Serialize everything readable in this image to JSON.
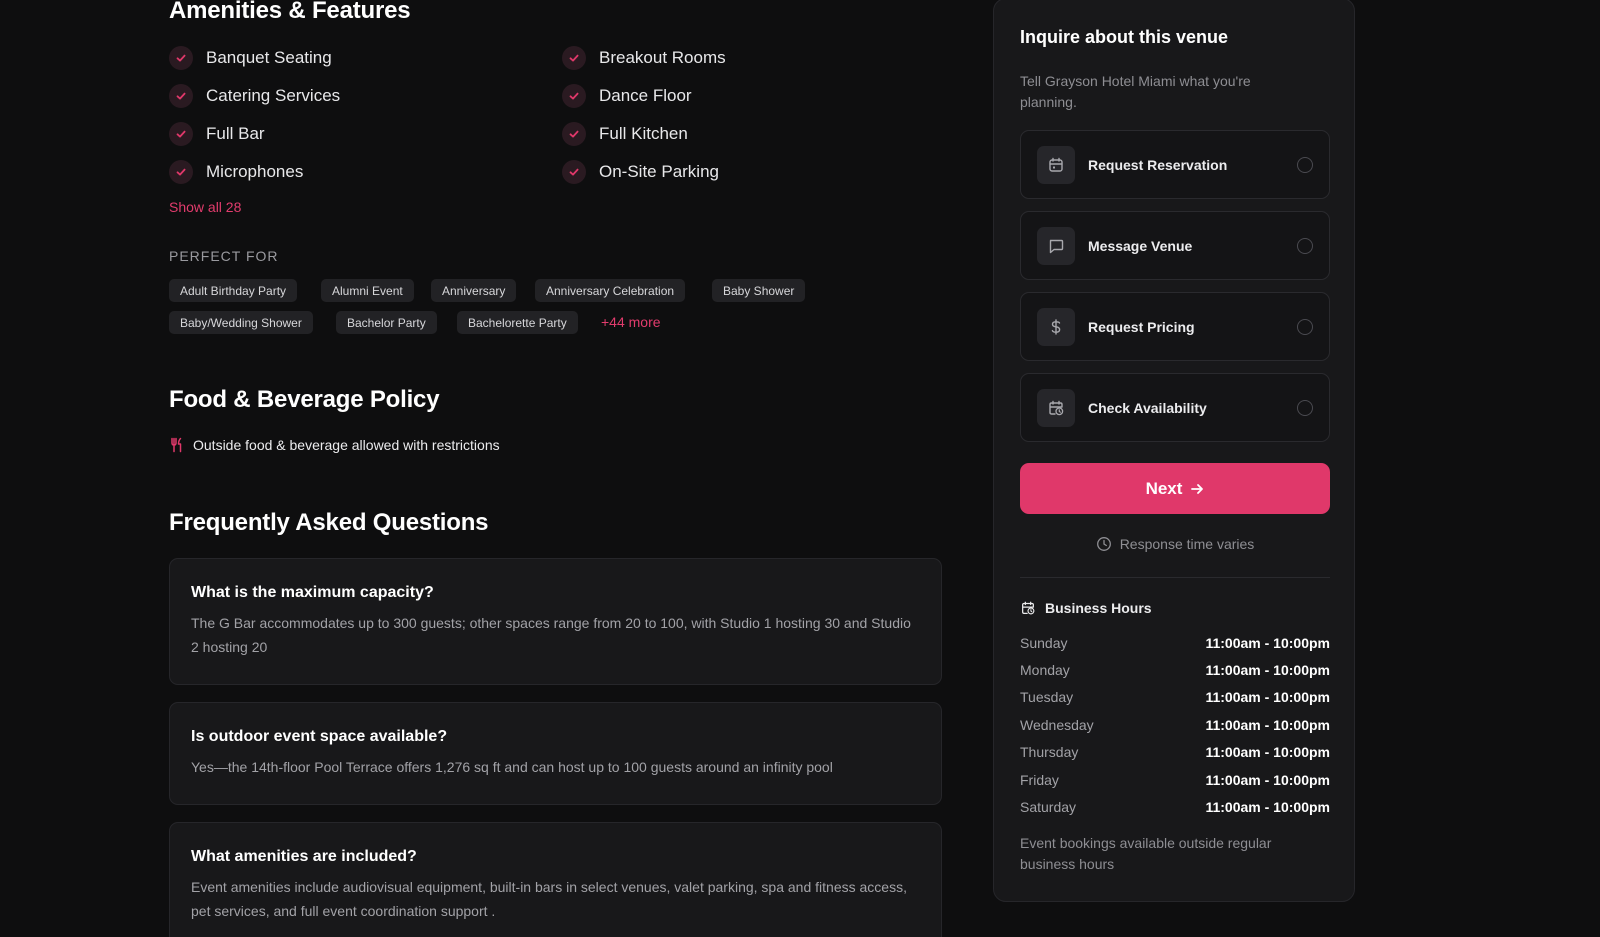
{
  "amenities": {
    "title": "Amenities & Features",
    "items": [
      "Banquet Seating",
      "Breakout Rooms",
      "Catering Services",
      "Dance Floor",
      "Full Bar",
      "Full Kitchen",
      "Microphones",
      "On-Site Parking"
    ],
    "show_all": "Show all 28"
  },
  "perfect_for": {
    "label": "PERFECT FOR",
    "tags": [
      "Adult Birthday Party",
      "Alumni Event",
      "Anniversary",
      "Anniversary Celebration",
      "Baby Shower",
      "Baby/Wedding Shower",
      "Bachelor Party",
      "Bachelorette Party"
    ],
    "more": "+44 more"
  },
  "food_beverage": {
    "title": "Food & Beverage Policy",
    "icon": "utensils-icon",
    "text": "Outside food & beverage allowed with restrictions"
  },
  "faq": {
    "title": "Frequently Asked Questions",
    "items": [
      {
        "q": "What is the maximum capacity?",
        "a": "The G Bar accommodates up to 300 guests; other spaces range from 20 to 100, with Studio 1 hosting 30 and Studio 2 hosting 20"
      },
      {
        "q": "Is outdoor event space available?",
        "a": "Yes—the 14th-floor Pool Terrace offers 1,276 sq ft and can host up to 100 guests around an infinity pool"
      },
      {
        "q": "What amenities are included?",
        "a": "Event amenities include audiovisual equipment, built-in bars in select venues, valet parking, spa and fitness access, pet services, and full event coordination support ."
      }
    ]
  },
  "inquire": {
    "title": "Inquire about this venue",
    "subtitle": "Tell Grayson Hotel Miami what you're planning.",
    "options": [
      {
        "label": "Request Reservation",
        "icon": "calendar-icon"
      },
      {
        "label": "Message Venue",
        "icon": "message-icon"
      },
      {
        "label": "Request Pricing",
        "icon": "dollar-icon"
      },
      {
        "label": "Check Availability",
        "icon": "calendar-clock-icon"
      }
    ],
    "next": "Next",
    "response": "Response time varies",
    "business_hours": {
      "title": "Business Hours",
      "rows": [
        {
          "day": "Sunday",
          "time": "11:00am - 10:00pm"
        },
        {
          "day": "Monday",
          "time": "11:00am - 10:00pm"
        },
        {
          "day": "Tuesday",
          "time": "11:00am - 10:00pm"
        },
        {
          "day": "Wednesday",
          "time": "11:00am - 10:00pm"
        },
        {
          "day": "Thursday",
          "time": "11:00am - 10:00pm"
        },
        {
          "day": "Friday",
          "time": "11:00am - 10:00pm"
        },
        {
          "day": "Saturday",
          "time": "11:00am - 10:00pm"
        }
      ],
      "note": "Event bookings available outside regular business hours"
    }
  },
  "colors": {
    "accent": "#e0386a",
    "background": "#0e0e0f",
    "card": "#18181a"
  }
}
